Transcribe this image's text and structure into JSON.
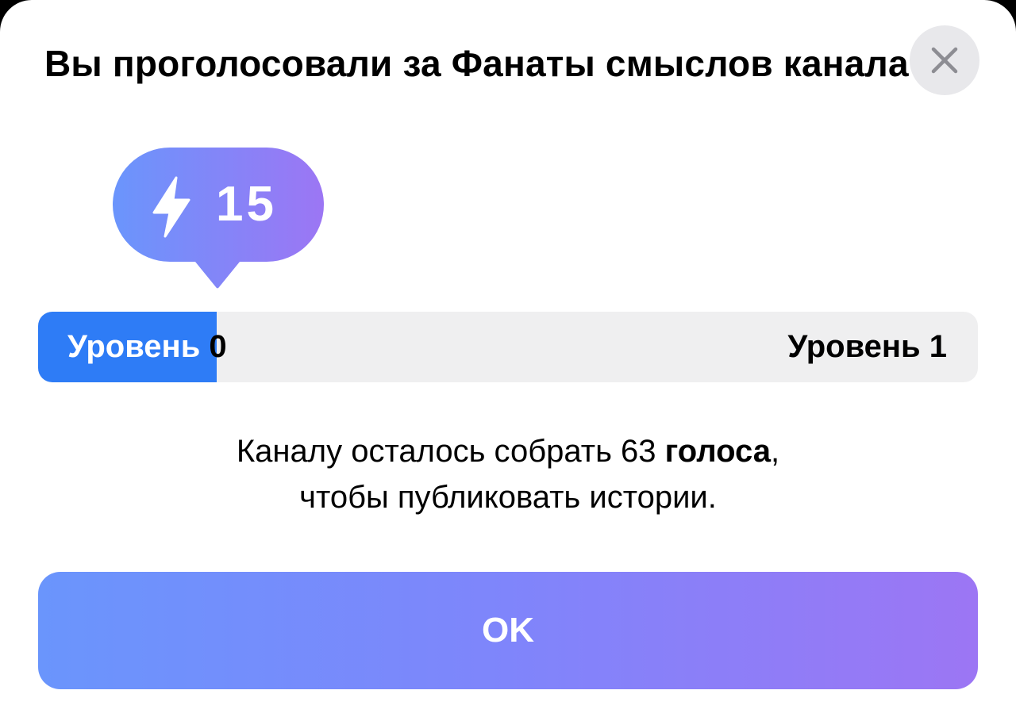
{
  "dialog": {
    "title": "Вы проголосовали за Фанаты смыслов канала",
    "close_icon": "close-icon"
  },
  "boost": {
    "icon": "lightning-bolt-icon",
    "count": "15",
    "gradient_start": "#6a95fc",
    "gradient_end": "#9c76f4"
  },
  "progress": {
    "current_level_word": "Уровень",
    "current_level_number": "0",
    "next_level": "Уровень 1",
    "fill_fraction": 0.19,
    "fill_color": "#2e7cf6",
    "track_color": "#efeff0"
  },
  "message": {
    "before": "Каналу осталось собрать 63 ",
    "bold": "голоса",
    "after_bold": ",",
    "line2": "чтобы публиковать истории."
  },
  "button": {
    "ok_label": "OK"
  }
}
